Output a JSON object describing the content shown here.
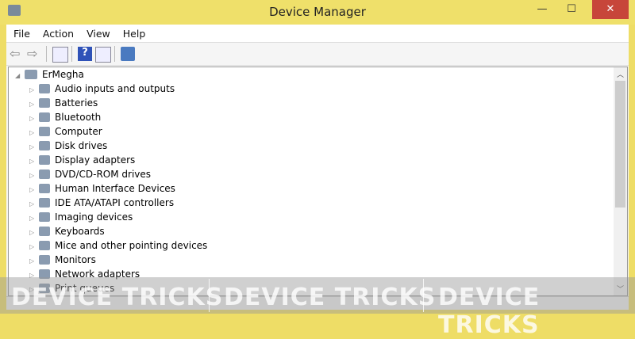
{
  "window": {
    "title": "Device Manager",
    "minimize": "—",
    "maximize": "☐",
    "close": "✕"
  },
  "menu": [
    "File",
    "Action",
    "View",
    "Help"
  ],
  "tree": {
    "root": "ErMegha",
    "items": [
      "Audio inputs and outputs",
      "Batteries",
      "Bluetooth",
      "Computer",
      "Disk drives",
      "Display adapters",
      "DVD/CD-ROM drives",
      "Human Interface Devices",
      "IDE ATA/ATAPI controllers",
      "Imaging devices",
      "Keyboards",
      "Mice and other pointing devices",
      "Monitors",
      "Network adapters",
      "Print queues"
    ]
  },
  "watermark": "DEVICE TRICKS"
}
